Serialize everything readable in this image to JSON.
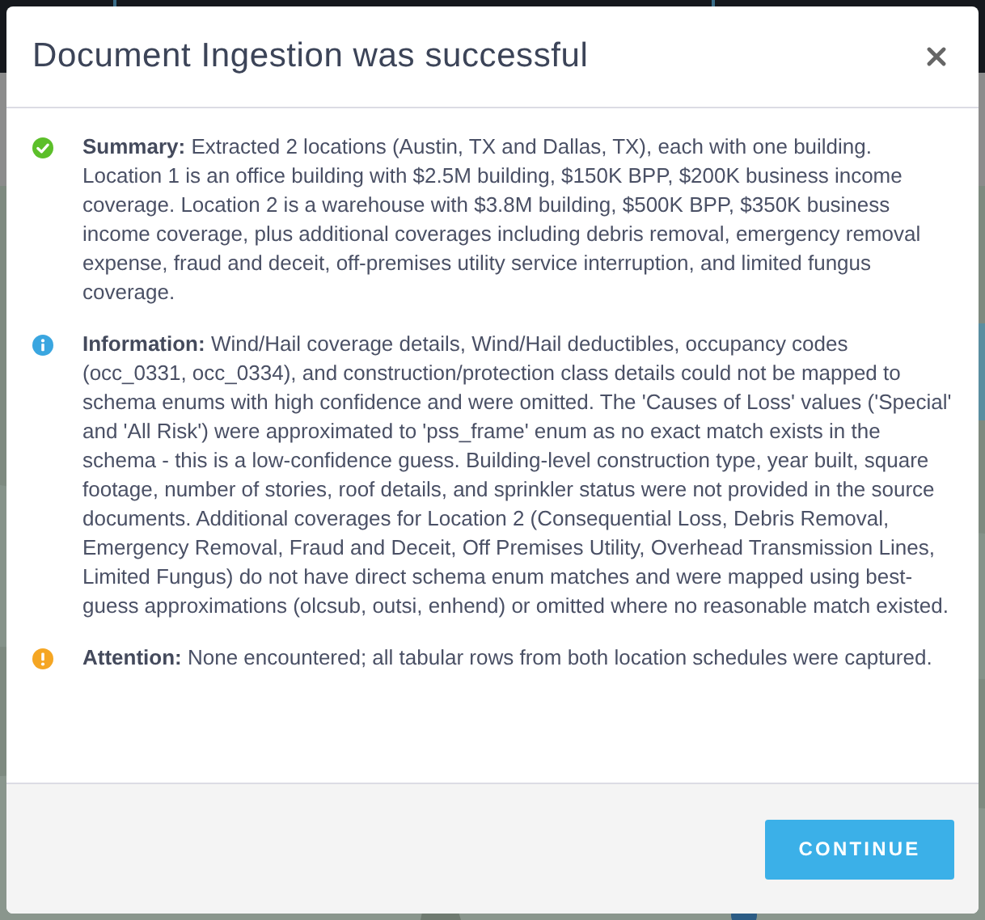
{
  "dialog": {
    "title": "Document Ingestion was successful",
    "messages": [
      {
        "kind": "success",
        "label": "Summary:",
        "text": "Extracted 2 locations (Austin, TX and Dallas, TX), each with one building. Location 1 is an office building with $2.5M building, $150K BPP, $200K business income coverage. Location 2 is a warehouse with $3.8M building, $500K BPP, $350K business income coverage, plus additional coverages including debris removal, emergency removal expense, fraud and deceit, off-premises utility service interruption, and limited fungus coverage."
      },
      {
        "kind": "info",
        "label": "Information:",
        "text": "Wind/Hail coverage details, Wind/Hail deductibles, occupancy codes (occ_0331, occ_0334), and construction/protection class details could not be mapped to schema enums with high confidence and were omitted. The 'Causes of Loss' values ('Special' and 'All Risk') were approximated to 'pss_frame' enum as no exact match exists in the schema - this is a low-confidence guess. Building-level construction type, year built, square footage, number of stories, roof details, and sprinkler status were not provided in the source documents. Additional coverages for Location 2 (Consequential Loss, Debris Removal, Emergency Removal, Fraud and Deceit, Off Premises Utility, Overhead Transmission Lines, Limited Fungus) do not have direct schema enum matches and were mapped using best-guess approximations (olcsub, outsi, enhend) or omitted where no reasonable match existed."
      },
      {
        "kind": "warning",
        "label": "Attention:",
        "text": "None encountered; all tabular rows from both location schedules were captured."
      }
    ],
    "button": "CONTINUE"
  }
}
